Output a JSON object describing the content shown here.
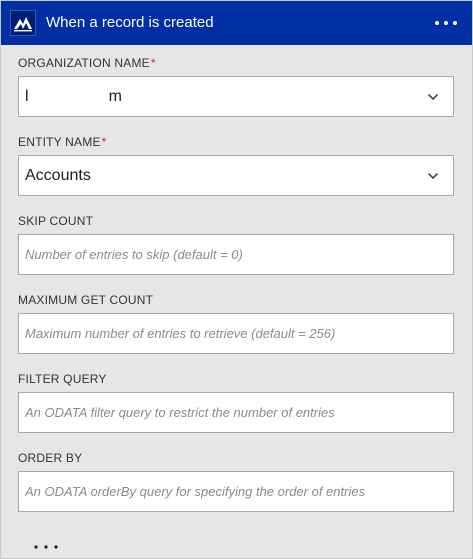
{
  "header": {
    "title": "When a record is created",
    "more_icon": "more-horizontal-icon",
    "logo_icon": "dynamics-crm-logo-icon"
  },
  "fields": {
    "organization_name": {
      "label": "ORGANIZATION NAME",
      "required_marker": "*",
      "value": "l                  m"
    },
    "entity_name": {
      "label": "ENTITY NAME",
      "required_marker": "*",
      "value": "Accounts"
    },
    "skip_count": {
      "label": "SKIP COUNT",
      "placeholder": "Number of entries to skip (default = 0)"
    },
    "maximum_get_count": {
      "label": "MAXIMUM GET COUNT",
      "placeholder": "Maximum number of entries to retrieve (default = 256)"
    },
    "filter_query": {
      "label": "FILTER QUERY",
      "placeholder": "An ODATA filter query to restrict the number of entries"
    },
    "order_by": {
      "label": "ORDER BY",
      "placeholder": "An ODATA orderBy query for specifying the order of entries"
    }
  },
  "footer": {
    "more_options_icon": "more-horizontal-icon"
  },
  "colors": {
    "header_bg": "#002fa3",
    "card_bg": "#e6e6e6",
    "required": "#e81123"
  }
}
